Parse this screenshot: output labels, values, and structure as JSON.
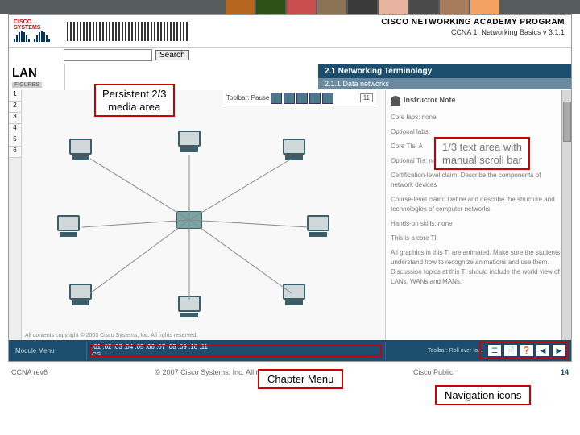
{
  "header": {
    "brand": "CISCO SYSTEMS",
    "program_title": "CISCO NETWORKING ACADEMY PROGRAM",
    "program_subtitle": "CCNA 1: Networking Basics v 3.1.1",
    "search_button": "Search",
    "search_placeholder": ""
  },
  "subheader": {
    "lan_label": "LAN",
    "figures_label": "FIGURES",
    "crumb1": "2.1   Networking Terminology",
    "crumb2": "2.1.1 Data networks",
    "figure_numbers": [
      "1",
      "2",
      "3",
      "4",
      "5",
      "6"
    ]
  },
  "toolbar": {
    "label": "Toolbar: Pause",
    "num": "11"
  },
  "callouts": {
    "media": "Persistent 2/3\nmedia area",
    "text": "1/3 text area with\nmanual scroll bar",
    "chapter_menu": "Chapter Menu",
    "nav_icons": "Navigation icons"
  },
  "text_panel": {
    "heading": "Instructor Note",
    "lines": [
      "Core labs: none",
      "Optional labs:",
      "Core TIs: A",
      "Optional TIs: none",
      "Certification-level claim: Describe the components of network devices",
      "Course-level claim: Define and describe the structure and technologies of computer networks",
      "Hands-on skills: none",
      "This is a core TI.",
      "All graphics in this TI are animated. Make sure the students understand how to recognize animations and use them. Discussion topics at this TI should include the world view of LANs, WANs and MANs."
    ]
  },
  "module_bar": {
    "menu_label": "Module Menu",
    "numbers": ".01 .02 .03 .04 .05 .06 .07 .08 .09 .10 .11",
    "course": "CS",
    "toolbar_label": "Toolbar: Roll over to..."
  },
  "media_copyright": "All contents copyright © 2003 Cisco Systems, Inc. All rights reserved.",
  "footer": {
    "left": "CCNA rev6",
    "center": "© 2007 Cisco Systems, Inc. All rights reserved.",
    "right_label": "Cisco Public",
    "page": "14"
  }
}
